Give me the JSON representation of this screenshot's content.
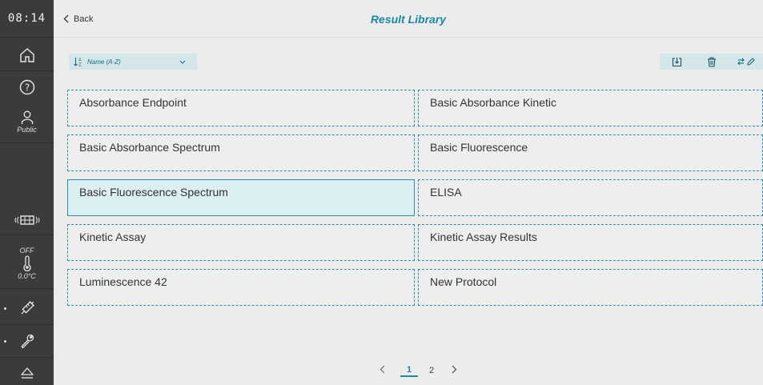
{
  "sidebar": {
    "clock": "08:14",
    "user_label": "Public",
    "temp_state": "OFF",
    "temp_value": "0.0°C"
  },
  "header": {
    "back_label": "Back",
    "title": "Result Library"
  },
  "toolbar": {
    "sort_label": "Name (A-Z)"
  },
  "protocols": [
    "Absorbance Endpoint",
    "Basic Absorbance Kinetic",
    "Basic Absorbance Spectrum",
    "Basic Fluorescence",
    "Basic Fluorescence Spectrum",
    "ELISA",
    "Kinetic Assay",
    "Kinetic Assay Results",
    "Luminescence 42",
    "New Protocol"
  ],
  "selected_index": 4,
  "pagination": {
    "pages": [
      "1",
      "2"
    ],
    "current": "1"
  },
  "colors": {
    "accent": "#1b8aa3",
    "sidebar": "#3b3b3b",
    "background": "#ececec",
    "selected_fill": "#dbeef1"
  }
}
